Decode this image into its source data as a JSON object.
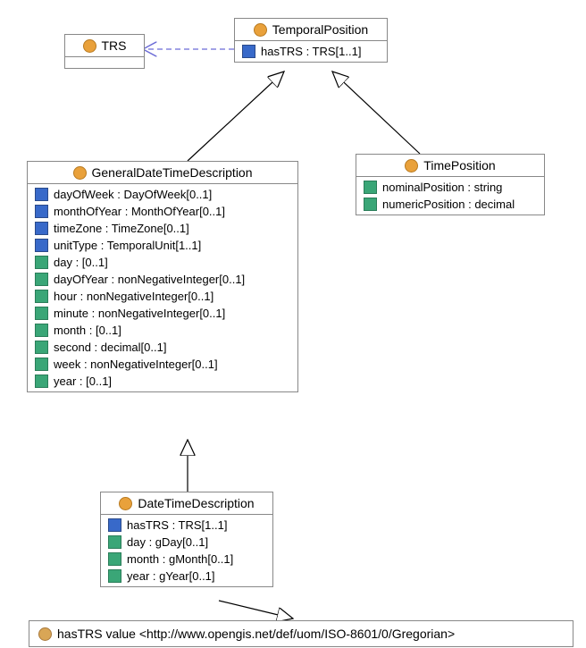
{
  "classes": {
    "trs": {
      "title": "TRS"
    },
    "temporalPosition": {
      "title": "TemporalPosition",
      "attrs": [
        {
          "icon": "blue",
          "text": "hasTRS : TRS[1..1]"
        }
      ]
    },
    "timePosition": {
      "title": "TimePosition",
      "attrs": [
        {
          "icon": "green",
          "text": "nominalPosition : string"
        },
        {
          "icon": "green",
          "text": "numericPosition : decimal"
        }
      ]
    },
    "generalDateTimeDescription": {
      "title": "GeneralDateTimeDescription",
      "attrs": [
        {
          "icon": "blue",
          "text": "dayOfWeek : DayOfWeek[0..1]"
        },
        {
          "icon": "blue",
          "text": "monthOfYear : MonthOfYear[0..1]"
        },
        {
          "icon": "blue",
          "text": "timeZone : TimeZone[0..1]"
        },
        {
          "icon": "blue",
          "text": "unitType : TemporalUnit[1..1]"
        },
        {
          "icon": "green",
          "text": "day : [0..1]"
        },
        {
          "icon": "green",
          "text": "dayOfYear : nonNegativeInteger[0..1]"
        },
        {
          "icon": "green",
          "text": "hour : nonNegativeInteger[0..1]"
        },
        {
          "icon": "green",
          "text": "minute : nonNegativeInteger[0..1]"
        },
        {
          "icon": "green",
          "text": "month : [0..1]"
        },
        {
          "icon": "green",
          "text": "second : decimal[0..1]"
        },
        {
          "icon": "green",
          "text": "week : nonNegativeInteger[0..1]"
        },
        {
          "icon": "green",
          "text": "year : [0..1]"
        }
      ]
    },
    "dateTimeDescription": {
      "title": "DateTimeDescription",
      "attrs": [
        {
          "icon": "blue",
          "text": "hasTRS : TRS[1..1]"
        },
        {
          "icon": "green",
          "text": "day : gDay[0..1]"
        },
        {
          "icon": "green",
          "text": "month : gMonth[0..1]"
        },
        {
          "icon": "green",
          "text": "year : gYear[0..1]"
        }
      ]
    }
  },
  "constraint": {
    "text": "hasTRS value <http://www.opengis.net/def/uom/ISO-8601/0/Gregorian>"
  }
}
